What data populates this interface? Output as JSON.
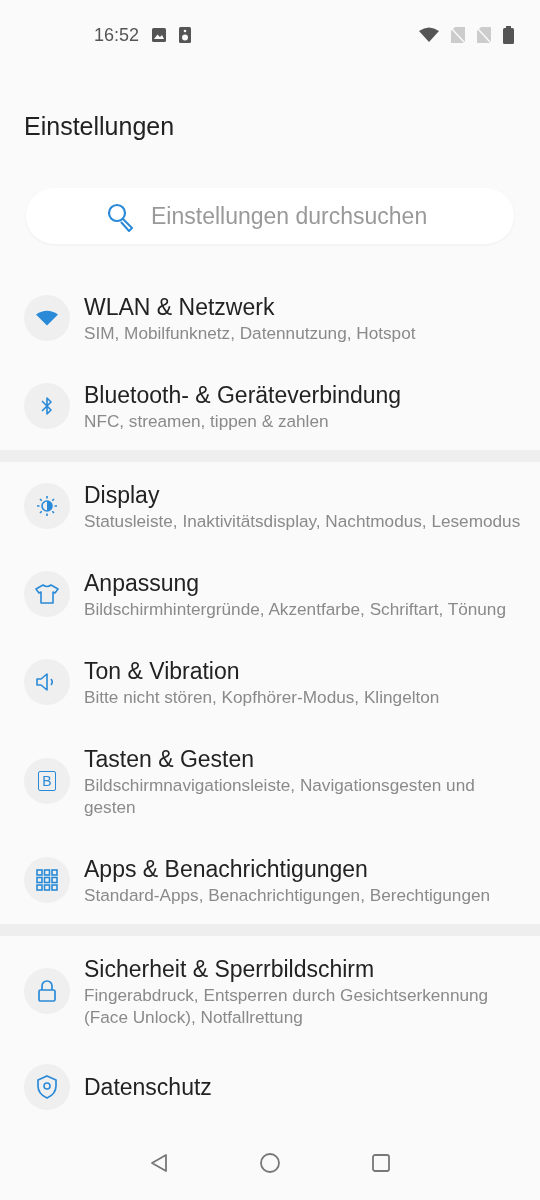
{
  "status_bar": {
    "time": "16:52"
  },
  "title": "Einstellungen",
  "search": {
    "placeholder": "Einstellungen durchsuchen"
  },
  "groups": [
    {
      "items": [
        {
          "kind": "wifi",
          "title": "WLAN & Netzwerk",
          "subtitle": "SIM, Mobilfunknetz, Datennutzung, Hotspot"
        },
        {
          "kind": "bluetooth",
          "title": "Bluetooth- & Geräteverbindung",
          "subtitle": "NFC, streamen, tippen & zahlen"
        }
      ]
    },
    {
      "items": [
        {
          "kind": "display",
          "title": "Display",
          "subtitle": "Statusleiste, Inaktivitätsdisplay, Nachtmodus, Lesemodus"
        },
        {
          "kind": "shirt",
          "title": "Anpassung",
          "subtitle": "Bildschirmhintergründe, Akzentfarbe, Schriftart, Tönung"
        },
        {
          "kind": "sound",
          "title": "Ton & Vibration",
          "subtitle": "Bitte nicht stören, Kopfhörer-Modus, Klingelton"
        },
        {
          "kind": "key",
          "icon_label": "B",
          "title": "Tasten & Gesten",
          "subtitle": "Bildschirmnavigationsleiste, Navigationsgesten und gesten"
        },
        {
          "kind": "apps",
          "title": "Apps & Benachrichtigungen",
          "subtitle": "Standard-Apps, Benachrichtigungen, Berechtigungen"
        }
      ]
    },
    {
      "items": [
        {
          "kind": "lock",
          "title": "Sicherheit & Sperrbildschirm",
          "subtitle": "Fingerabdruck, Entsperren durch Gesichtserkennung (Face Unlock), Notfallrettung"
        },
        {
          "kind": "shield",
          "title": "Datenschutz"
        }
      ]
    }
  ]
}
